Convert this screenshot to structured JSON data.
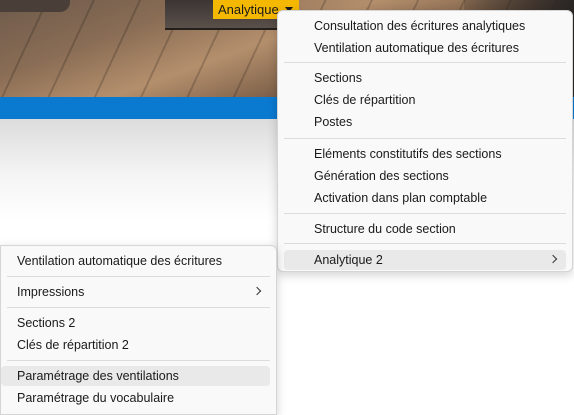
{
  "trigger": {
    "label": "Analytique"
  },
  "submenu_right": {
    "groups": [
      [
        "Consultation des écritures analytiques",
        "Ventilation automatique des écritures"
      ],
      [
        "Sections",
        "Clés de répartition",
        "Postes"
      ],
      [
        "Eléments constitutifs des sections",
        "Génération des sections",
        "Activation dans plan comptable"
      ],
      [
        "Structure du code section"
      ]
    ],
    "submenu_item": "Analytique 2"
  },
  "submenu_left": {
    "items": {
      "ventilation": "Ventilation automatique des écritures",
      "impressions": "Impressions",
      "sections2": "Sections 2",
      "cles2": "Clés de répartition 2",
      "param_ventilations": "Paramétrage des ventilations",
      "param_vocabulaire": "Paramétrage du vocabulaire"
    }
  },
  "colors": {
    "accent": "#0a7ad1",
    "trigger": "#f5b800",
    "menu_bg": "#f9f9f9",
    "hover": "#e9e9e9"
  },
  "icons": {
    "chevron": "chevron-right-icon",
    "caret": "caret-down-icon"
  }
}
